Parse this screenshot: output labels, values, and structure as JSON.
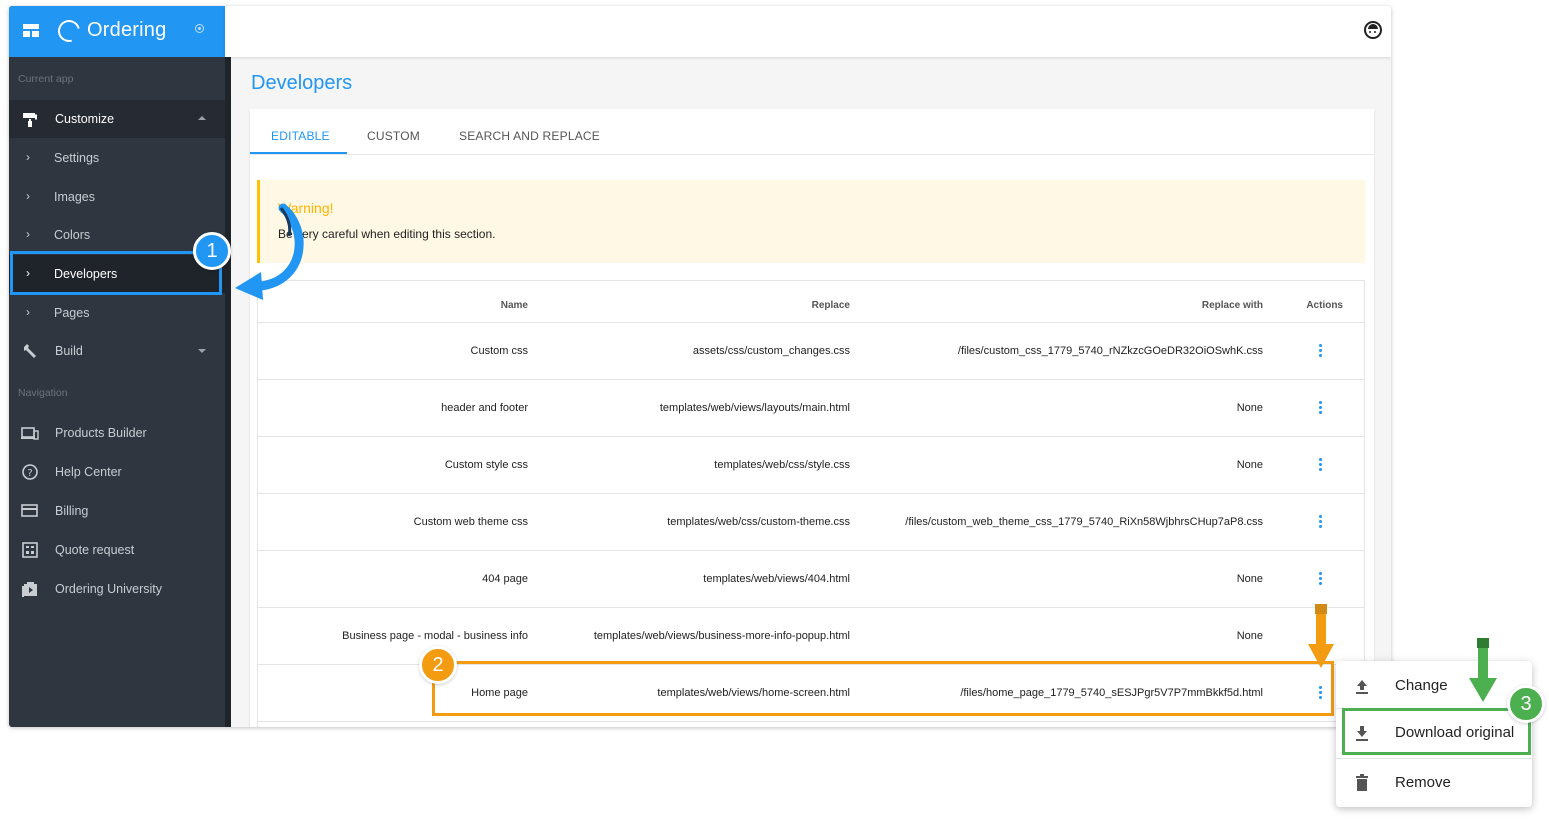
{
  "brand": {
    "name": "Ordering"
  },
  "sidebar": {
    "section_current": "Current app",
    "customize": "Customize",
    "sub_items": [
      "Settings",
      "Images",
      "Colors",
      "Developers",
      "Pages"
    ],
    "build": "Build",
    "section_navigation": "Navigation",
    "nav_items": [
      {
        "label": "Products Builder",
        "icon": "devices-icon"
      },
      {
        "label": "Help Center",
        "icon": "help-circle-icon"
      },
      {
        "label": "Billing",
        "icon": "credit-card-icon"
      },
      {
        "label": "Quote request",
        "icon": "calculator-icon"
      },
      {
        "label": "Ordering University",
        "icon": "video-library-icon"
      }
    ]
  },
  "page": {
    "title": "Developers"
  },
  "tabs": [
    "EDITABLE",
    "CUSTOM",
    "SEARCH AND REPLACE"
  ],
  "warning": {
    "title": "Warning!",
    "text": "Be very careful when editing this section."
  },
  "table": {
    "headers": {
      "name": "Name",
      "replace": "Replace",
      "replace_with": "Replace with",
      "actions": "Actions"
    },
    "rows": [
      {
        "name": "Custom css",
        "replace": "assets/css/custom_changes.css",
        "replace_with": "/files/custom_css_1779_5740_rNZkzcGOeDR32OiOSwhK.css"
      },
      {
        "name": "header and footer",
        "replace": "templates/web/views/layouts/main.html",
        "replace_with": "None"
      },
      {
        "name": "Custom style css",
        "replace": "templates/web/css/style.css",
        "replace_with": "None"
      },
      {
        "name": "Custom web theme css",
        "replace": "templates/web/css/custom-theme.css",
        "replace_with": "/files/custom_web_theme_css_1779_5740_RiXn58WjbhrsCHup7aP8.css"
      },
      {
        "name": "404 page",
        "replace": "templates/web/views/404.html",
        "replace_with": "None"
      },
      {
        "name": "Business page - modal - business info",
        "replace": "templates/web/views/business-more-info-popup.html",
        "replace_with": "None"
      },
      {
        "name": "Home page",
        "replace": "templates/web/views/home-screen.html",
        "replace_with": "/files/home_page_1779_5740_sESJPgr5V7P7mmBkkf5d.html"
      }
    ]
  },
  "dropdown": {
    "change": "Change",
    "download": "Download original",
    "remove": "Remove"
  },
  "annotations": {
    "step1": "1",
    "step2": "2",
    "step3": "3"
  },
  "colors": {
    "accent": "#2196f3",
    "step1": "#2196f3",
    "step2": "#f39c12",
    "step3": "#4caf50",
    "warning": "#ffb300"
  }
}
